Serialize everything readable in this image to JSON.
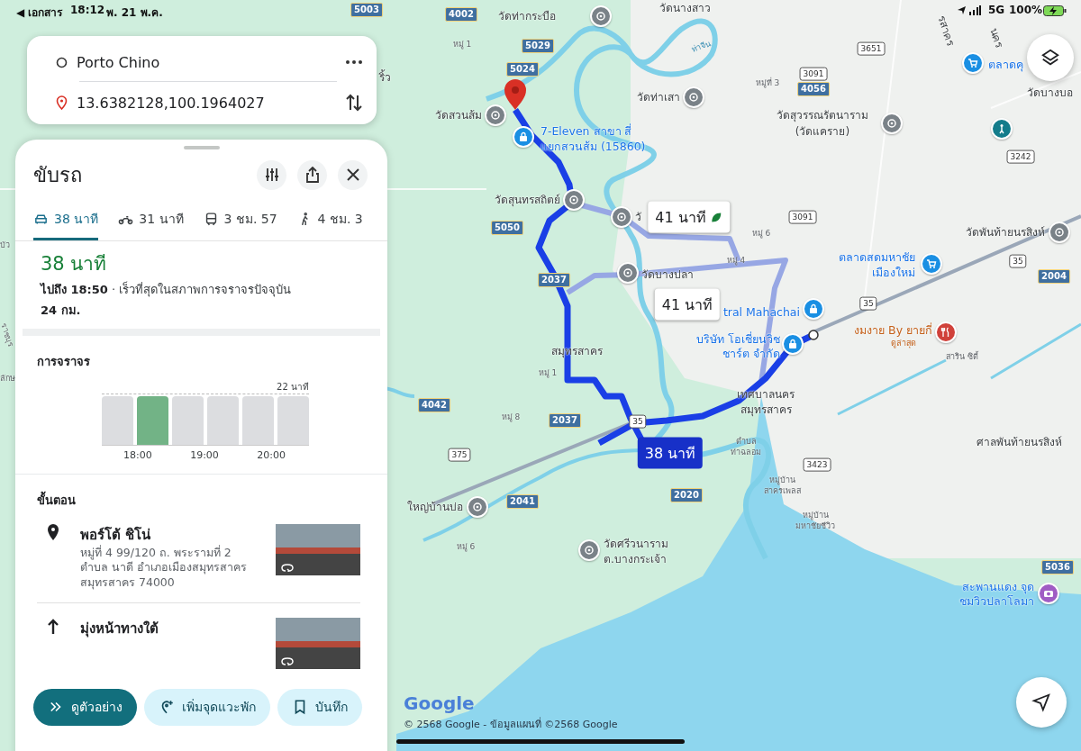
{
  "status_bar": {
    "back": "◀ เอกสาร",
    "time": "18:12",
    "date": "พ. 21 พ.ค.",
    "network": "5G",
    "battery": "100%"
  },
  "search": {
    "origin": "Porto Chino",
    "destination": "13.6382128,100.1964027"
  },
  "panel": {
    "title": "ขับรถ",
    "modes": [
      {
        "kind": "car",
        "label": "38 นาที",
        "selected": true
      },
      {
        "kind": "motorbike",
        "label": "31 นาที",
        "selected": false
      },
      {
        "kind": "transit",
        "label": "3 ชม. 57",
        "selected": false
      },
      {
        "kind": "walk",
        "label": "4 ชม. 3",
        "selected": false
      }
    ],
    "summary": {
      "duration": "38 นาที",
      "arrival": "ไปถึง 18:50",
      "separator": "·",
      "note": "เร็วที่สุดในสภาพการจราจรปัจจุบัน",
      "distance": "24 กม."
    },
    "traffic": {
      "heading": "การจราจร",
      "max_label": "22 นาที",
      "bars": [
        {
          "selected": false
        },
        {
          "selected": true
        },
        {
          "selected": false
        },
        {
          "selected": false
        },
        {
          "selected": false
        },
        {
          "selected": false
        }
      ],
      "times": [
        "18:00",
        "19:00",
        "20:00"
      ]
    },
    "steps_heading": "ขั้นตอน",
    "steps": [
      {
        "kind": "pin",
        "title": "พอร์โต้ ชิโน่",
        "detail": "หมู่ที่ 4 99/120 ถ. พระรามที่ 2 ตำบล นาดี อำเภอเมืองสมุทรสาคร สมุทรสาคร 74000"
      },
      {
        "kind": "straight",
        "title": "มุ่งหน้าทางใต้"
      }
    ],
    "actions": [
      {
        "kind": "preview",
        "label": "ดูตัวอย่าง",
        "primary": true
      },
      {
        "kind": "add-stop",
        "label": "เพิ่มจุดแวะพัก",
        "primary": false
      },
      {
        "kind": "save",
        "label": "บันทึก",
        "primary": false
      }
    ]
  },
  "map": {
    "labels": [
      {
        "kind": "road",
        "text": "5003"
      },
      {
        "kind": "road",
        "text": "4002"
      },
      {
        "kind": "place",
        "text": "วัดท่ากระบือ"
      },
      {
        "kind": "place",
        "text": "วัดนางสาว"
      },
      {
        "kind": "small",
        "text": "หมู่ 1"
      },
      {
        "kind": "road",
        "text": "5029"
      },
      {
        "kind": "road",
        "text": "5024"
      },
      {
        "kind": "place",
        "text": "วัดสวนส้ม"
      },
      {
        "kind": "poi",
        "text": "7-Eleven สาขา สี่"
      },
      {
        "kind": "poi",
        "text": "แยกสวนส้ม (15860)"
      },
      {
        "kind": "river",
        "text": "ท่าจีน"
      },
      {
        "kind": "place",
        "text": "วัดท่าเสา"
      },
      {
        "kind": "sign",
        "text": "3651"
      },
      {
        "kind": "small",
        "text": "หมู่ที่ 3"
      },
      {
        "kind": "sign",
        "text": "3091"
      },
      {
        "kind": "road",
        "text": "4056"
      },
      {
        "kind": "poi",
        "text": "ตลาดคุ"
      },
      {
        "kind": "place",
        "text": "วัดบางบอ"
      },
      {
        "kind": "place",
        "text": "วัดสุวรรณรัตนาราม"
      },
      {
        "kind": "place",
        "text": "(วัดแคราย)"
      },
      {
        "kind": "sign",
        "text": "3242"
      },
      {
        "kind": "place",
        "text": "วัดสุนทรสถิตย์"
      },
      {
        "kind": "road",
        "text": "5050"
      },
      {
        "kind": "place",
        "text": "วั"
      },
      {
        "kind": "sign",
        "text": "3091"
      },
      {
        "kind": "small",
        "text": "หมู่ 6"
      },
      {
        "kind": "small",
        "text": "หมู่ 4"
      },
      {
        "kind": "place",
        "text": "วัดพันท้ายนรสิงห์"
      },
      {
        "kind": "poi",
        "text": "ตลาดสดมหาชัย"
      },
      {
        "kind": "poi",
        "text": "เมืองใหม่"
      },
      {
        "kind": "sign",
        "text": "35"
      },
      {
        "kind": "road",
        "text": "2004"
      },
      {
        "kind": "road",
        "text": "2037"
      },
      {
        "kind": "place",
        "text": "วัดบางปลา"
      },
      {
        "kind": "poi",
        "text": "tral Mahachai"
      },
      {
        "kind": "sign",
        "text": "35"
      },
      {
        "kind": "poi",
        "text": "บริษัท โอเชี่ยนวิช"
      },
      {
        "kind": "poi",
        "text": "ชาร์ต จำกัด"
      },
      {
        "kind": "food",
        "text": "งมงาย By ยายกี่"
      },
      {
        "kind": "food-note",
        "text": "ดูล่าสุด"
      },
      {
        "kind": "place",
        "text": "สมุทรสาคร"
      },
      {
        "kind": "small",
        "text": "สาริน ซิตี้"
      },
      {
        "kind": "small",
        "text": "หมู่ 1"
      },
      {
        "kind": "place",
        "text": "เทศบาลนคร"
      },
      {
        "kind": "place",
        "text": "สมุทรสาคร"
      },
      {
        "kind": "road",
        "text": "4042"
      },
      {
        "kind": "small",
        "text": "หมู่ 8"
      },
      {
        "kind": "road",
        "text": "2037"
      },
      {
        "kind": "sign",
        "text": "35"
      },
      {
        "kind": "place",
        "text": "ศาลพันท้ายนรสิงห์"
      },
      {
        "kind": "sign",
        "text": "375"
      },
      {
        "kind": "small",
        "text": "ตำบล"
      },
      {
        "kind": "small",
        "text": "ท่าฉลอม"
      },
      {
        "kind": "sign",
        "text": "3423"
      },
      {
        "kind": "small",
        "text": "หมู่บ้าน"
      },
      {
        "kind": "small",
        "text": "สาครเพลส"
      },
      {
        "kind": "road",
        "text": "2020"
      },
      {
        "kind": "road",
        "text": "2041"
      },
      {
        "kind": "place",
        "text": "ใหญ่บ้านบ่อ"
      },
      {
        "kind": "small",
        "text": "หมู่บ้าน"
      },
      {
        "kind": "small",
        "text": "มหาชัยชีวิว"
      },
      {
        "kind": "place",
        "text": "วัดศรีวนาราม"
      },
      {
        "kind": "place",
        "text": "ต.บางกระเจ้า"
      },
      {
        "kind": "small",
        "text": "หมู่ 6"
      },
      {
        "kind": "road",
        "text": "5036"
      },
      {
        "kind": "poi",
        "text": "สะพานแดง จุด"
      },
      {
        "kind": "poi",
        "text": "ชมวิวปลาโลมา"
      },
      {
        "kind": "place",
        "text": "ริ้ว"
      },
      {
        "kind": "small",
        "text": "บัว"
      },
      {
        "kind": "small",
        "text": "ราชบุร"
      },
      {
        "kind": "small",
        "text": "ลักษ"
      },
      {
        "kind": "place",
        "text": "รสาคร"
      },
      {
        "kind": "place",
        "text": "นคร"
      }
    ],
    "route_times": [
      {
        "text": "41 นาที",
        "selected": false,
        "eco": true
      },
      {
        "text": "41 นาที",
        "selected": false,
        "eco": false
      },
      {
        "text": "38 นาที",
        "selected": true,
        "eco": false
      }
    ],
    "logo": "Google",
    "attribution": "© 2568 Google - ข้อมูลแผนที่ ©2568 Google"
  }
}
